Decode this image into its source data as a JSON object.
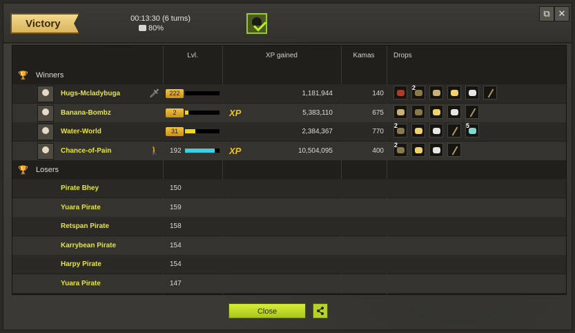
{
  "header": {
    "result_label": "Victory",
    "duration": "00:13:30 (6 turns)",
    "bonus_percent": "80%",
    "icons": {
      "chest": "chest-icon",
      "challenge": "skull-check-icon",
      "detach": "detach-icon",
      "close": "close-icon"
    }
  },
  "table": {
    "columns": {
      "level": "Lvl.",
      "xp": "XP gained",
      "kamas": "Kamas",
      "drops": "Drops"
    },
    "winners_label": "Winners",
    "losers_label": "Losers",
    "winners": [
      {
        "name": "Hugs-Mcladybuga",
        "level": "222",
        "level_badge": true,
        "xp_fill": 0.0,
        "xp_bonus": false,
        "xp_gained": "1,181,944",
        "kamas": "140",
        "status_icon": "sword-icon",
        "drops": [
          {
            "qty": "",
            "color": "#b03a2e"
          },
          {
            "qty": "2",
            "color": "#8a7a4a"
          },
          {
            "qty": "",
            "color": "#c9b27a"
          },
          {
            "qty": "",
            "color": "#f2d36a"
          },
          {
            "qty": "",
            "color": "#e6e6e6"
          },
          {
            "qty": "",
            "color": "stick"
          }
        ]
      },
      {
        "name": "Banana-Bombz",
        "level": "2",
        "level_badge": true,
        "xp_fill": 0.1,
        "xp_bonus": true,
        "xp_gained": "5,383,110",
        "kamas": "675",
        "status_icon": "",
        "drops": [
          {
            "qty": "",
            "color": "#c9b27a"
          },
          {
            "qty": "",
            "color": "#8a7a4a"
          },
          {
            "qty": "",
            "color": "#f2d36a"
          },
          {
            "qty": "",
            "color": "#e6e6e6"
          },
          {
            "qty": "",
            "color": "stick"
          }
        ]
      },
      {
        "name": "Water-World",
        "level": "31",
        "level_badge": true,
        "xp_fill": 0.3,
        "xp_bonus": false,
        "xp_gained": "2,384,367",
        "kamas": "770",
        "status_icon": "",
        "drops": [
          {
            "qty": "2",
            "color": "#8a7a4a"
          },
          {
            "qty": "",
            "color": "#f2d36a"
          },
          {
            "qty": "",
            "color": "#e6e6e6"
          },
          {
            "qty": "",
            "color": "stick"
          },
          {
            "qty": "5",
            "color": "#7fd8d0"
          }
        ]
      },
      {
        "name": "Chance-of-Pain",
        "level": "192",
        "level_badge": false,
        "xp_fill": 0.85,
        "xp_bonus": true,
        "xp_gained": "10,504,095",
        "kamas": "400",
        "status_icon": "person-icon",
        "drops": [
          {
            "qty": "2",
            "color": "#8a7a4a"
          },
          {
            "qty": "",
            "color": "#f2d36a"
          },
          {
            "qty": "",
            "color": "#e6e6e6"
          },
          {
            "qty": "",
            "color": "stick"
          }
        ]
      }
    ],
    "xp_bonus_label": "XP",
    "losers": [
      {
        "name": "Pirate Bhey",
        "level": "150"
      },
      {
        "name": "Yuara Pirate",
        "level": "159"
      },
      {
        "name": "Retspan Pirate",
        "level": "158"
      },
      {
        "name": "Karrybean Pirate",
        "level": "154"
      },
      {
        "name": "Harpy Pirate",
        "level": "154"
      },
      {
        "name": "Yuara Pirate",
        "level": "147"
      }
    ]
  },
  "footer": {
    "close_label": "Close"
  }
}
